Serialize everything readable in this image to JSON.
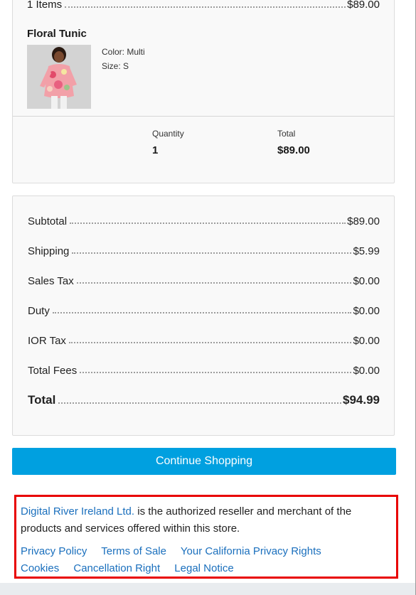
{
  "order": {
    "items_label": "1 Items",
    "items_amount": "$89.00",
    "product": {
      "name": "Floral Tunic",
      "color": "Color: Multi",
      "size": "Size: S",
      "image_alt": "Floral Tunic"
    },
    "quantity_label": "Quantity",
    "quantity_value": "1",
    "total_label": "Total",
    "total_value": "$89.00"
  },
  "summary": {
    "rows": [
      {
        "label": "Subtotal",
        "value": "$89.00"
      },
      {
        "label": "Shipping",
        "value": "$5.99"
      },
      {
        "label": "Sales Tax",
        "value": "$0.00"
      },
      {
        "label": "Duty",
        "value": "$0.00"
      },
      {
        "label": "IOR Tax",
        "value": "$0.00"
      },
      {
        "label": "Total Fees",
        "value": "$0.00"
      }
    ],
    "total_label": "Total",
    "total_value": "$94.99"
  },
  "continue_label": "Continue Shopping",
  "legal": {
    "reseller_link": "Digital River Ireland Ltd.",
    "reseller_text": " is the authorized reseller and merchant of the products and services offered within this store.",
    "links_row1": [
      "Privacy Policy",
      "Terms of Sale",
      "Your California Privacy Rights"
    ],
    "links_row2": [
      "Cookies",
      "Cancellation Right",
      "Legal Notice"
    ]
  },
  "colors": {
    "button": "#00a0e0",
    "link": "#1a6fbd",
    "highlight_border": "#e80000"
  }
}
